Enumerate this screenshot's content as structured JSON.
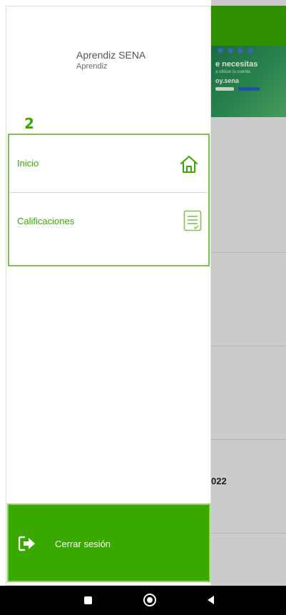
{
  "user": {
    "name": "Aprendiz SENA",
    "role": "Aprendiz"
  },
  "annotation": {
    "step": "2"
  },
  "menu": {
    "items": [
      {
        "label": "Inicio",
        "icon": "home-icon"
      },
      {
        "label": "Calificaciones",
        "icon": "document-check-icon"
      }
    ]
  },
  "logout": {
    "label": "Cerrar sesión",
    "icon": "logout-icon"
  },
  "background": {
    "banner_line1": "e necesitas",
    "banner_line2": "a utilizar tu cuenta",
    "banner_line3": "oy.sena",
    "text": "022"
  },
  "colors": {
    "accent": "#39a900",
    "box_outline": "#7fc24f",
    "scrim": "rgba(0,0,0,0.14)"
  },
  "system_nav": {
    "buttons": [
      "recents-button",
      "home-button",
      "back-button"
    ]
  }
}
